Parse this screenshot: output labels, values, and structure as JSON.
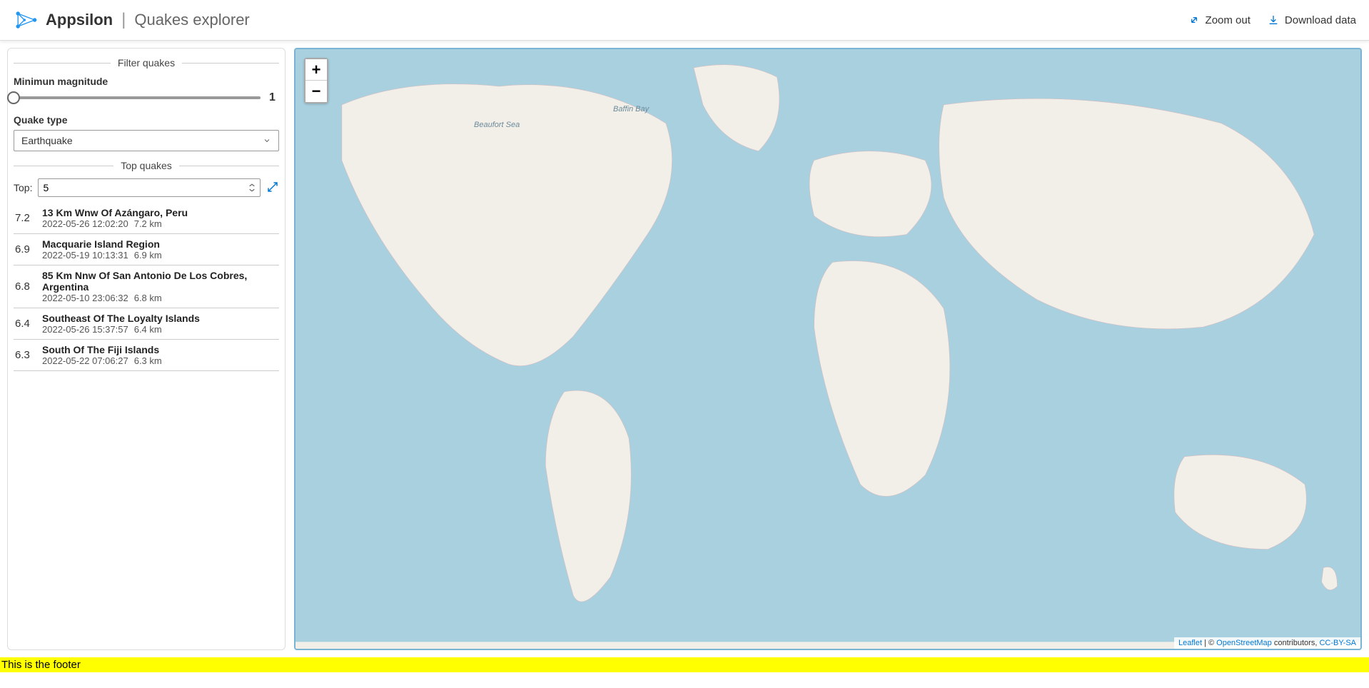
{
  "header": {
    "brand": "Appsilon",
    "title": "Quakes explorer",
    "actions": {
      "zoom_out": "Zoom out",
      "download": "Download data"
    }
  },
  "sidebar": {
    "filter_section": "Filter quakes",
    "min_mag_label": "Minimun magnitude",
    "min_mag_value": "1",
    "quake_type_label": "Quake type",
    "quake_type_selected": "Earthquake",
    "top_section": "Top quakes",
    "top_label": "Top:",
    "top_value": "5"
  },
  "quakes": [
    {
      "mag": "7.2",
      "place": "13 Km Wnw Of Azángaro, Peru",
      "time": "2022-05-26 12:02:20",
      "depth": "7.2 km"
    },
    {
      "mag": "6.9",
      "place": "Macquarie Island Region",
      "time": "2022-05-19 10:13:31",
      "depth": "6.9 km"
    },
    {
      "mag": "6.8",
      "place": "85 Km Nnw Of San Antonio De Los Cobres, Argentina",
      "time": "2022-05-10 23:06:32",
      "depth": "6.8 km"
    },
    {
      "mag": "6.4",
      "place": "Southeast Of The Loyalty Islands",
      "time": "2022-05-26 15:37:57",
      "depth": "6.4 km"
    },
    {
      "mag": "6.3",
      "place": "South Of The Fiji Islands",
      "time": "2022-05-22 07:06:27",
      "depth": "6.3 km"
    }
  ],
  "map": {
    "labels": {
      "beaufort": "Beaufort Sea",
      "baffin": "Baffin Bay"
    },
    "zoom_in": "+",
    "zoom_out": "−",
    "attribution": {
      "leaflet": "Leaflet",
      "sep": " | © ",
      "osm": "OpenStreetMap",
      "contrib": " contributors, ",
      "license": "CC-BY-SA"
    }
  },
  "footer": "This is the footer"
}
